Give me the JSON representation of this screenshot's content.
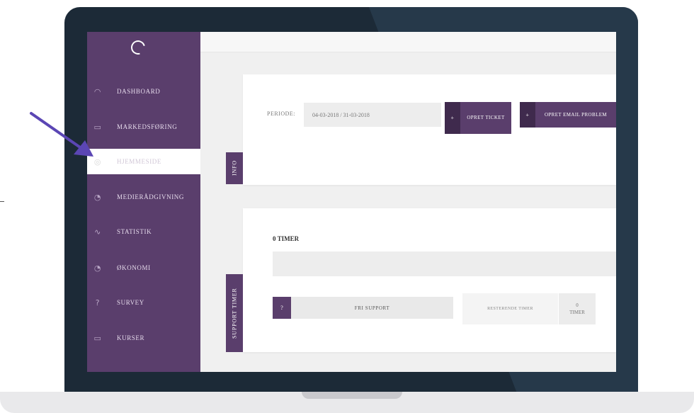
{
  "sidebar": {
    "items": [
      {
        "icon": "dashboard-icon",
        "label": "DASHBOARD"
      },
      {
        "icon": "briefcase-icon",
        "label": "MARKEDSFØRING"
      },
      {
        "icon": "globe-icon",
        "label": "HJEMMESIDE",
        "active": true
      },
      {
        "icon": "gauge-icon",
        "label": "MEDIERÅDGIVNING"
      },
      {
        "icon": "pulse-icon",
        "label": "STATISTIK"
      },
      {
        "icon": "gauge-icon",
        "label": "ØKONOMI"
      },
      {
        "icon": "question-icon",
        "label": "SURVEY"
      },
      {
        "icon": "folder-icon",
        "label": "KURSER"
      }
    ]
  },
  "info_card": {
    "tab_label": "INFO",
    "period_label": "PERIODE:",
    "period_value": "04-03-2018 / 31-03-2018",
    "create_ticket": {
      "plus": "+",
      "label": "OPRET TICKET"
    },
    "create_email_problem": {
      "plus": "+",
      "label": "OPRET EMAIL PROBLEM"
    }
  },
  "support_card": {
    "tab_label": "SUPPORT TIMER",
    "hours_heading": "0 TIMER",
    "help_button": "?",
    "free_support": "FRI SUPPORT",
    "remaining_label": "RESTERENDE TIMER",
    "remaining_value": "0",
    "remaining_unit": "TIMER"
  },
  "colors": {
    "brand": "#5a3e6c",
    "brand_dark": "#3f2a4d",
    "arrow": "#5b46b4",
    "laptop": "#1c2a37"
  }
}
